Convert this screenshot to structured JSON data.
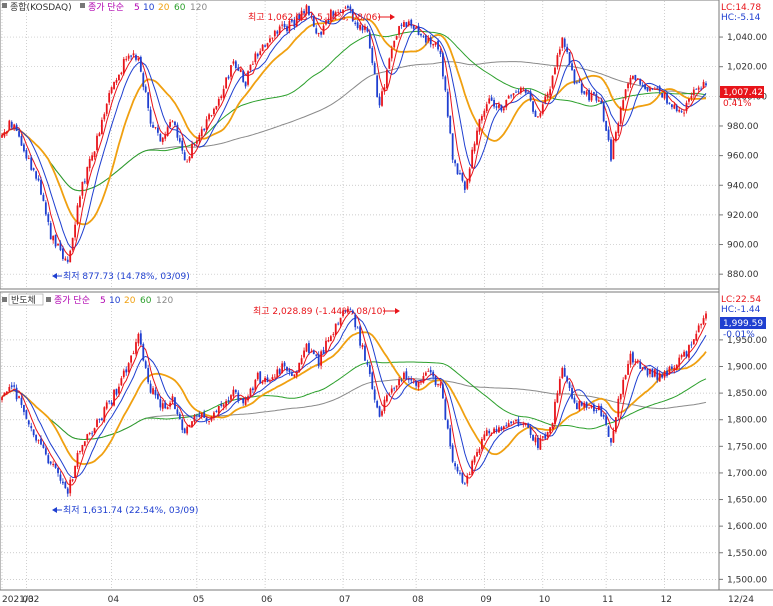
{
  "top_panel": {
    "label": "종합(KOSDAQ)",
    "legend_prefix": "종가 단순",
    "ma": [
      "5",
      "10",
      "20",
      "60",
      "120"
    ],
    "lc_label": "LC:14.78",
    "hc_label": "HC:-5.14",
    "price_box": "1,007.42",
    "change": "0.41%",
    "high_note": "최고 1,062.03 (-5.14%, 08/06)",
    "low_note": "최저 877.73 (14.78%, 03/09)"
  },
  "bottom_panel": {
    "label": "반도체",
    "legend_prefix": "종가 단순",
    "ma": [
      "5",
      "10",
      "20",
      "60",
      "120"
    ],
    "lc_label": "LC:22.54",
    "hc_label": "HC:-1.44",
    "price_box": "1,999.59",
    "change": "-0.01%",
    "high_note": "최고 2,028.89 (-1.44%, 08/10)",
    "low_note": "최저 1,631.74 (22.54%, 03/09)"
  },
  "x_axis": {
    "labels": [
      "2021/02",
      "03",
      "04",
      "05",
      "06",
      "07",
      "08",
      "09",
      "10",
      "11",
      "12"
    ],
    "right_label": "12/24"
  },
  "colors": {
    "up": "#e8141a",
    "down": "#1f3fd0",
    "ma5": "#e8141a",
    "ma10": "#1f3fd0",
    "ma20": "#f0a010",
    "ma60": "#2ca02c",
    "ma120": "#8a8a8a",
    "grid": "#bdbdbd",
    "annotation_high": "#e8141a",
    "annotation_low": "#1f3fd0"
  },
  "chart_data": [
    {
      "type": "candlestick",
      "title": "종합(KOSDAQ)",
      "ylim": [
        870,
        1065
      ],
      "y_ticks": [
        "880.00",
        "900.00",
        "920.00",
        "940.00",
        "960.00",
        "980.00",
        "1,000.00",
        "1,020.00",
        "1,040.00"
      ],
      "last_close": 1007.42,
      "keyframes": {
        "days": [
          0,
          5,
          10,
          15,
          20,
          27,
          32,
          37,
          44,
          52,
          56,
          61,
          65,
          70,
          75,
          80,
          85,
          90,
          95,
          100,
          105,
          110,
          115,
          120,
          125,
          130,
          135,
          142,
          145,
          150,
          155,
          160,
          165,
          170,
          175,
          180,
          185,
          190,
          195,
          200,
          205,
          210,
          215,
          220,
          225,
          230,
          235,
          240,
          245,
          250,
          255,
          258,
          262,
          266,
          270,
          275,
          280,
          285,
          289
        ],
        "closes": [
          975,
          984,
          960,
          940,
          905,
          888,
          935,
          960,
          1000,
          1030,
          1026,
          985,
          968,
          985,
          955,
          972,
          985,
          1000,
          1025,
          1010,
          1030,
          1040,
          1045,
          1050,
          1058,
          1040,
          1055,
          1060,
          1050,
          1045,
          992,
          1035,
          1050,
          1045,
          1038,
          1030,
          960,
          935,
          978,
          1000,
          990,
          1005,
          1003,
          985,
          1005,
          1040,
          1010,
          1000,
          1000,
          960,
          1000,
          1015,
          1010,
          1005,
          1002,
          995,
          990,
          1005,
          1007.42
        ]
      }
    },
    {
      "type": "candlestick",
      "title": "반도체",
      "ylim": [
        1480,
        2040
      ],
      "y_ticks": [
        "1,500.00",
        "1,550.00",
        "1,600.00",
        "1,650.00",
        "1,700.00",
        "1,750.00",
        "1,800.00",
        "1,850.00",
        "1,900.00",
        "1,950.00"
      ],
      "last_close": 1999.59,
      "keyframes": {
        "days": [
          0,
          5,
          10,
          15,
          20,
          27,
          32,
          37,
          44,
          52,
          56,
          61,
          65,
          70,
          75,
          80,
          85,
          90,
          95,
          100,
          105,
          110,
          115,
          120,
          125,
          130,
          135,
          142,
          145,
          150,
          155,
          160,
          165,
          170,
          175,
          180,
          185,
          190,
          195,
          200,
          205,
          210,
          215,
          220,
          225,
          230,
          235,
          240,
          245,
          250,
          255,
          258,
          262,
          266,
          270,
          275,
          280,
          285,
          289
        ],
        "closes": [
          1840,
          1860,
          1800,
          1760,
          1720,
          1660,
          1750,
          1780,
          1830,
          1900,
          1955,
          1860,
          1820,
          1840,
          1770,
          1810,
          1800,
          1820,
          1850,
          1830,
          1880,
          1870,
          1900,
          1880,
          1940,
          1910,
          1960,
          2010,
          1980,
          1900,
          1810,
          1860,
          1880,
          1870,
          1895,
          1860,
          1720,
          1680,
          1740,
          1780,
          1790,
          1800,
          1790,
          1750,
          1780,
          1890,
          1830,
          1820,
          1820,
          1760,
          1880,
          1920,
          1900,
          1890,
          1880,
          1900,
          1920,
          1960,
          1999.59
        ]
      }
    }
  ]
}
